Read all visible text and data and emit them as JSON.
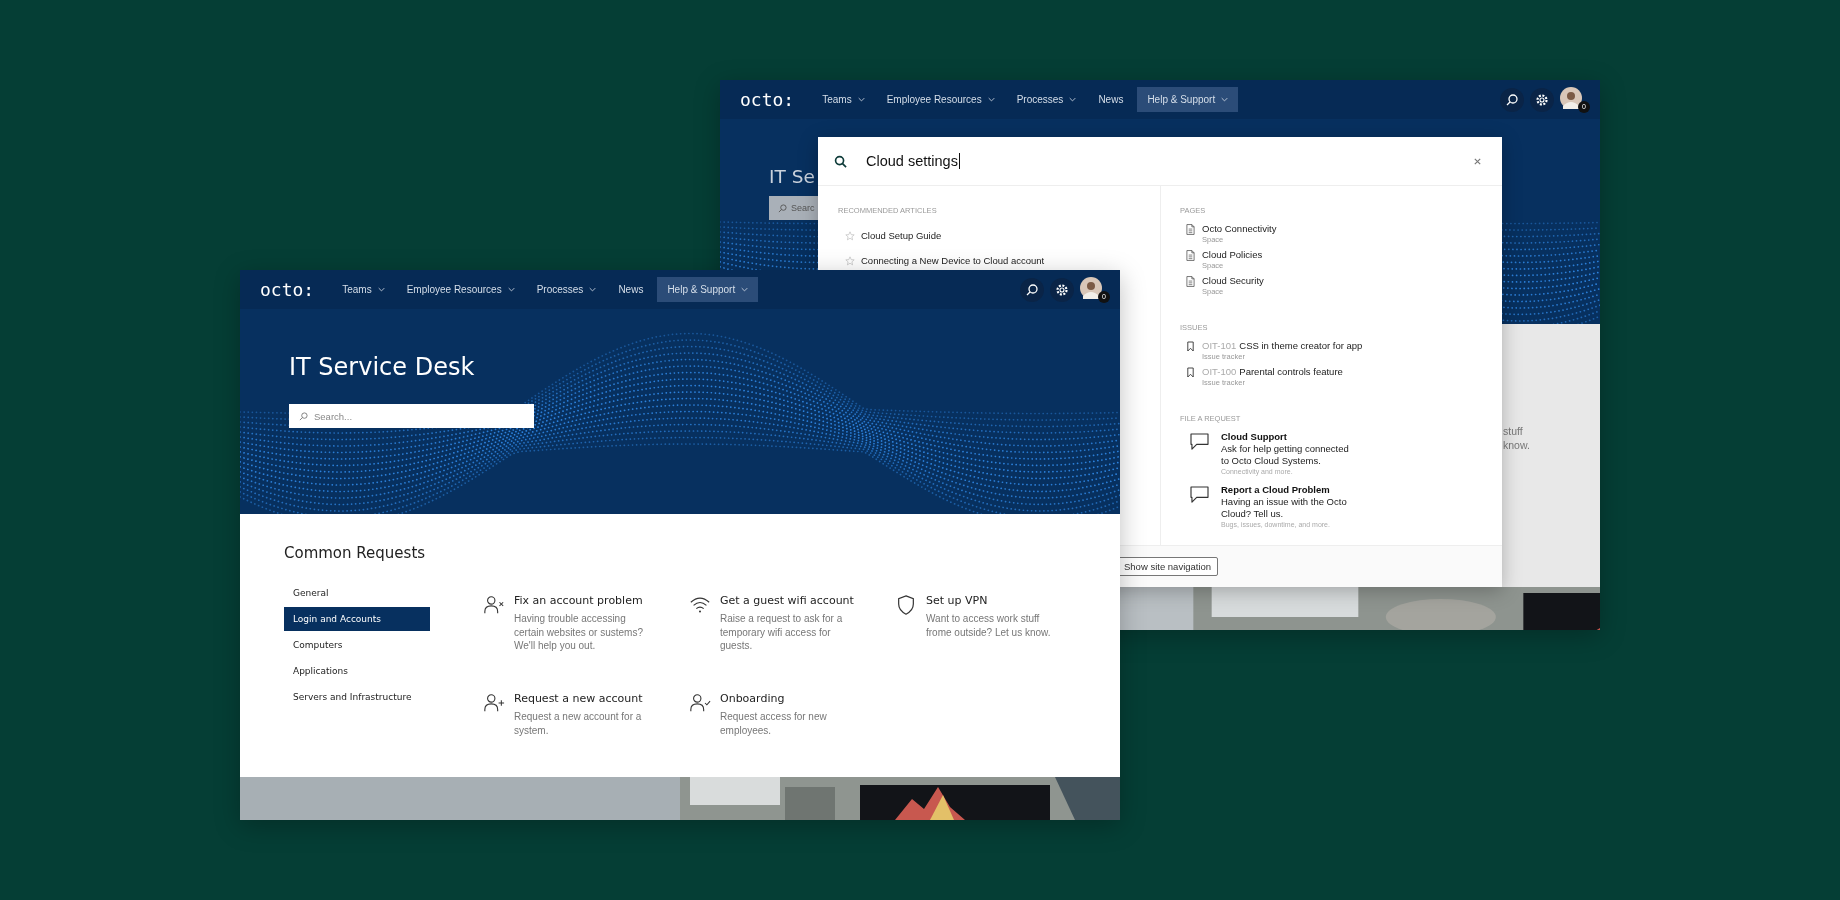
{
  "back_window": {
    "nav": {
      "logo": "octo:",
      "items": [
        {
          "label": "Teams",
          "dropdown": true,
          "selected": false
        },
        {
          "label": "Employee Resources",
          "dropdown": true,
          "selected": false
        },
        {
          "label": "Processes",
          "dropdown": true,
          "selected": false
        },
        {
          "label": "News",
          "dropdown": false,
          "selected": false
        },
        {
          "label": "Help & Support",
          "dropdown": true,
          "selected": true
        }
      ],
      "notification_count": "0"
    },
    "hero": {
      "title": "IT Se",
      "search_placeholder": "Searc"
    },
    "side_text": [
      "stuff",
      "know."
    ],
    "search_overlay": {
      "query": "Cloud settings",
      "recommended": {
        "heading": "RECOMMENDED ARTICLES",
        "items": [
          "Cloud Setup Guide",
          "Connecting a New Device to Cloud account"
        ]
      },
      "pages": {
        "heading": "PAGES",
        "items": [
          {
            "title": "Octo Connectivity",
            "sub": "Space"
          },
          {
            "title": "Cloud Policies",
            "sub": "Space"
          },
          {
            "title": "Cloud Security",
            "sub": "Space"
          }
        ]
      },
      "issues": {
        "heading": "ISSUES",
        "items": [
          {
            "key": "OIT-101",
            "title": "CSS in theme creator for app",
            "sub": "Issue tracker"
          },
          {
            "key": "OIT-100",
            "title": "Parental controls feature",
            "sub": "Issue tracker"
          }
        ]
      },
      "requests": {
        "heading": "FILE A REQUEST",
        "items": [
          {
            "title": "Cloud Support",
            "description": "Ask for help getting connected to Octo Cloud Systems.",
            "sub": "Connectivity and more."
          },
          {
            "title": "Report a Cloud Problem",
            "description": "Having an issue with the Octo Cloud? Tell us.",
            "sub": "Bugs, issues, downtime, and more."
          }
        ]
      },
      "footer_button": "Show site navigation"
    }
  },
  "front_window": {
    "nav": {
      "logo": "octo:",
      "items": [
        {
          "label": "Teams",
          "dropdown": true,
          "selected": false
        },
        {
          "label": "Employee Resources",
          "dropdown": true,
          "selected": false
        },
        {
          "label": "Processes",
          "dropdown": true,
          "selected": false
        },
        {
          "label": "News",
          "dropdown": false,
          "selected": false
        },
        {
          "label": "Help & Support",
          "dropdown": true,
          "selected": true
        }
      ],
      "notification_count": "0"
    },
    "hero": {
      "title": "IT Service Desk",
      "search_placeholder": "Search..."
    },
    "section_title": "Common Requests",
    "categories": [
      {
        "label": "General",
        "selected": false
      },
      {
        "label": "Login and Accounts",
        "selected": true
      },
      {
        "label": "Computers",
        "selected": false
      },
      {
        "label": "Applications",
        "selected": false
      },
      {
        "label": "Servers and Infrastructure",
        "selected": false
      }
    ],
    "requests": [
      {
        "kind": "user-x",
        "title": "Fix an account problem",
        "description": "Having trouble accessing certain websites or sustems? We'll help you out."
      },
      {
        "kind": "wifi",
        "title": "Get a guest wifi account",
        "description": "Raise a request to ask for a temporary wifi access for guests."
      },
      {
        "kind": "shield",
        "title": "Set up VPN",
        "description": "Want to access work stuff frome outside? Let us know."
      },
      {
        "kind": "user-plus",
        "title": "Request a new account",
        "description": "Request a new account for a system."
      },
      {
        "kind": "user-check",
        "title": "Onboarding",
        "description": "Request access for new employees."
      }
    ]
  }
}
